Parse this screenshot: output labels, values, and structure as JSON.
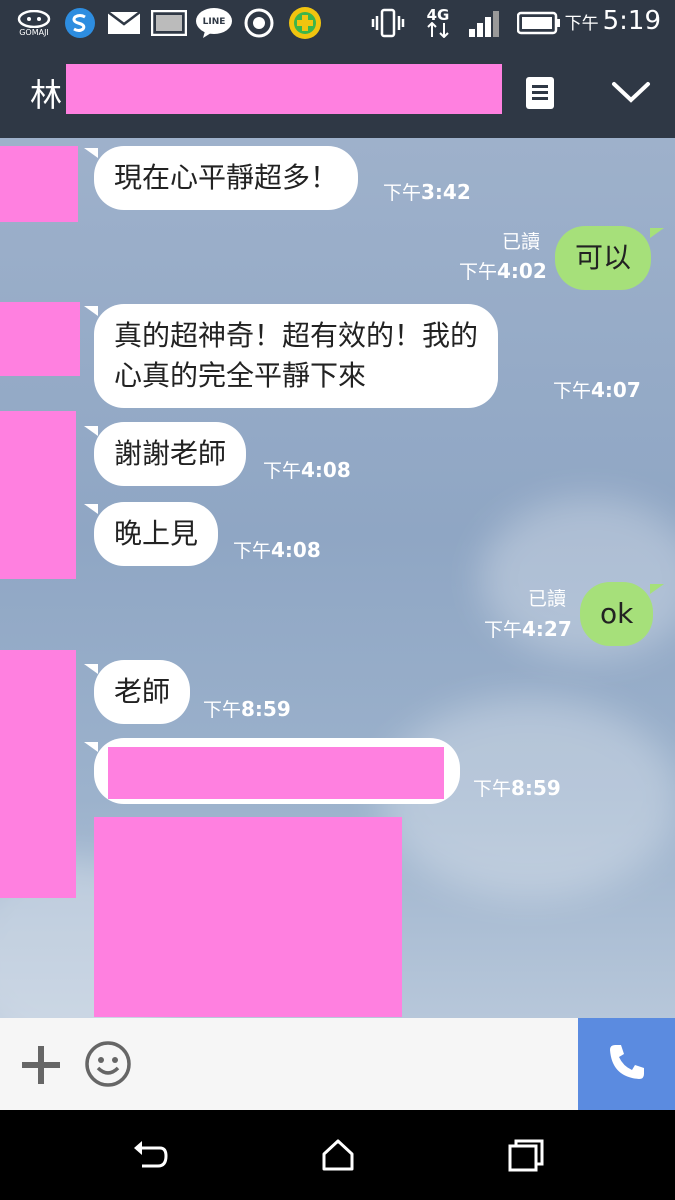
{
  "status_bar": {
    "icons": [
      "gomaji-icon",
      "s-app-icon",
      "mail-icon",
      "image-icon",
      "line-icon",
      "record-icon",
      "plus-app-icon",
      "vibrate-icon",
      "4g-icon",
      "signal-icon",
      "battery-icon"
    ],
    "gomaji_label": "GOMAJI",
    "line_label": "LINE",
    "network_label": "4G",
    "time_prefix": "下午",
    "time": "5:19"
  },
  "header": {
    "title_initial": "林"
  },
  "chat": {
    "messages": [
      {
        "dir": "in",
        "text": "現在心平靜超多！",
        "time_prefix": "下午",
        "time": "3:42"
      },
      {
        "dir": "out",
        "text": "可以",
        "read": "已讀",
        "time_prefix": "下午",
        "time": "4:02"
      },
      {
        "dir": "in",
        "line1": "真的超神奇！超有效的！我的",
        "line2": "心真的完全平靜下來",
        "time_prefix": "下午",
        "time": "4:07"
      },
      {
        "dir": "in",
        "text": "謝謝老師",
        "time_prefix": "下午",
        "time": "4:08"
      },
      {
        "dir": "in",
        "text": "晚上見",
        "time_prefix": "下午",
        "time": "4:08"
      },
      {
        "dir": "out",
        "text": "ok",
        "read": "已讀",
        "time_prefix": "下午",
        "time": "4:27"
      },
      {
        "dir": "in",
        "text": "老師",
        "time_prefix": "下午",
        "time": "8:59"
      },
      {
        "dir": "in",
        "text": "",
        "time_prefix": "下午",
        "time": "8:59"
      }
    ]
  },
  "input_bar": {
    "icons": [
      "plus-icon",
      "emoji-icon",
      "phone-icon"
    ]
  },
  "nav_bar": {
    "icons": [
      "back-icon",
      "home-icon",
      "recents-icon"
    ]
  },
  "colors": {
    "header_bg": "#2f3845",
    "out_bubble": "#a6e07a",
    "in_bubble": "#ffffff",
    "call_button": "#5b8be0",
    "redaction": "#ff80e0"
  }
}
